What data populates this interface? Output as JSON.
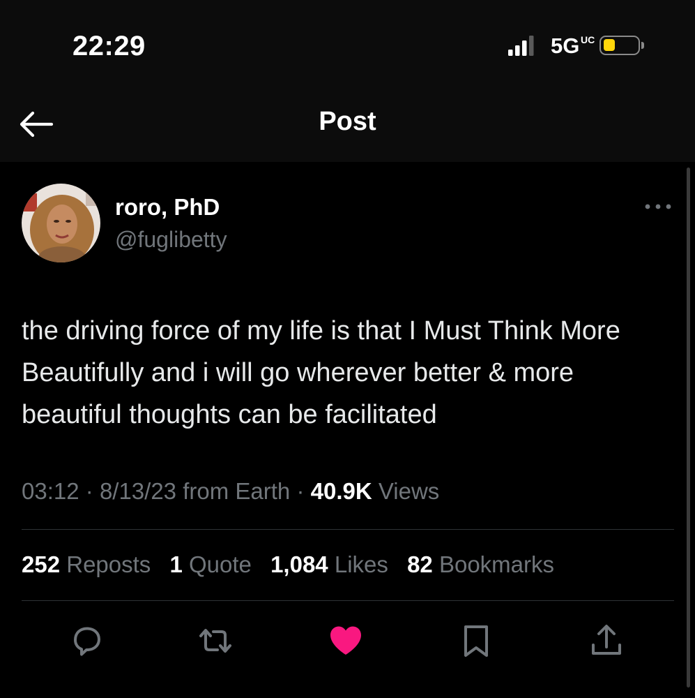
{
  "status_bar": {
    "time": "22:29",
    "network": "5G",
    "network_suffix": "UC",
    "battery_color": "#ffd60a"
  },
  "header": {
    "title": "Post",
    "back_icon": "arrow-left-icon"
  },
  "author": {
    "display_name": "roro, PhD",
    "handle": "@fuglibetty",
    "more_icon": "more-dots-icon"
  },
  "post": {
    "text": "the driving force of my life is that I Must Think More Beautifully and i will go wherever better & more beautiful thoughts can be facilitated",
    "time": "03:12",
    "separator": "·",
    "date": "8/13/23",
    "source": "from Earth",
    "views_count": "40.9K",
    "views_label": "Views"
  },
  "stats": {
    "reposts_count": "252",
    "reposts_label": "Reposts",
    "quotes_count": "1",
    "quotes_label": "Quote",
    "likes_count": "1,084",
    "likes_label": "Likes",
    "bookmarks_count": "82",
    "bookmarks_label": "Bookmarks"
  },
  "actions": {
    "icons": [
      "reply-icon",
      "repost-icon",
      "like-heart-icon",
      "bookmark-icon",
      "share-icon"
    ],
    "liked": true,
    "like_color": "#f91880",
    "icon_color": "#71767b"
  }
}
